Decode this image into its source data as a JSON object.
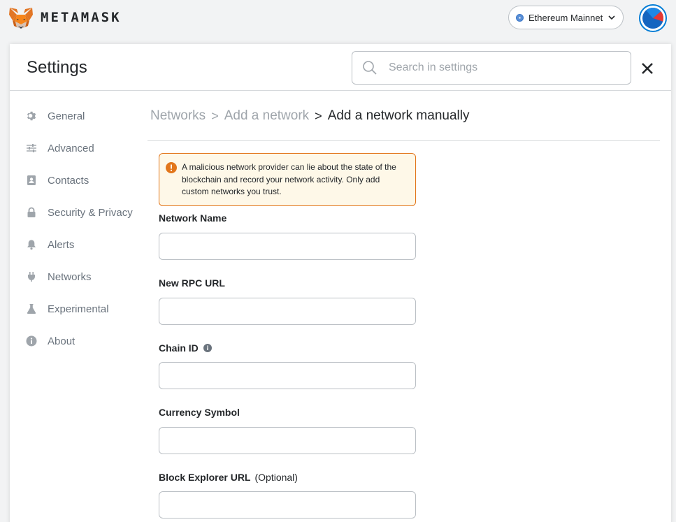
{
  "app": {
    "wordmark": "METAMASK"
  },
  "network": {
    "label": "Ethereum Mainnet"
  },
  "settings": {
    "title": "Settings",
    "search_placeholder": "Search in settings"
  },
  "sidebar": {
    "items": [
      {
        "label": "General",
        "icon": "gear-icon"
      },
      {
        "label": "Advanced",
        "icon": "sliders-icon"
      },
      {
        "label": "Contacts",
        "icon": "address-book-icon"
      },
      {
        "label": "Security & Privacy",
        "icon": "lock-icon"
      },
      {
        "label": "Alerts",
        "icon": "bell-icon"
      },
      {
        "label": "Networks",
        "icon": "plug-icon"
      },
      {
        "label": "Experimental",
        "icon": "flask-icon"
      },
      {
        "label": "About",
        "icon": "info-icon"
      }
    ]
  },
  "breadcrumb": {
    "items": [
      "Networks",
      "Add a network",
      "Add a network manually"
    ],
    "separator": ">"
  },
  "warning": {
    "text": "A malicious network provider can lie about the state of the blockchain and record your network activity. Only add custom networks you trust."
  },
  "form": {
    "network_name_label": "Network Name",
    "network_name_value": "",
    "rpc_url_label": "New RPC URL",
    "rpc_url_value": "",
    "chain_id_label": "Chain ID",
    "chain_id_value": "",
    "currency_symbol_label": "Currency Symbol",
    "currency_symbol_value": "",
    "block_explorer_label": "Block Explorer URL",
    "block_explorer_optional": "(Optional)",
    "block_explorer_value": ""
  },
  "colors": {
    "accent": "#037dd6",
    "warning_border": "#e2761b",
    "warning_bg": "#fef8e8",
    "text_muted": "#6a737d"
  }
}
